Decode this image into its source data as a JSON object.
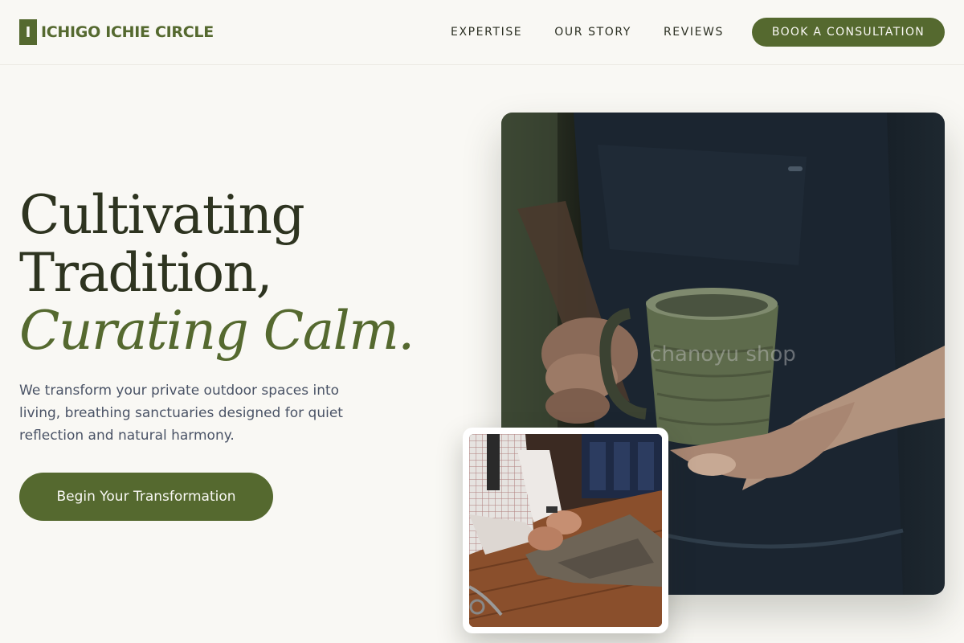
{
  "brand": {
    "mark": "I",
    "name": "ICHIGO ICHIE CIRCLE",
    "accent_color": "#55692f"
  },
  "nav": {
    "items": [
      {
        "label": "EXPERTISE"
      },
      {
        "label": "OUR STORY"
      },
      {
        "label": "REVIEWS"
      }
    ],
    "cta_label": "BOOK A CONSULTATION"
  },
  "hero": {
    "heading_line1": "Cultivating",
    "heading_line2": "Tradition,",
    "heading_accent": "Curating Calm.",
    "subtext": "We transform your private outdoor spaces into living, breathing sanctuaries designed for quiet reflection and natural harmony.",
    "button_label": "Begin Your Transformation"
  },
  "images": {
    "main_watermark": "chanoyu shop",
    "main_image_subject": "hands-holding-ceramic-mug",
    "inset_image_subject": "tailor-cutting-fabric"
  }
}
